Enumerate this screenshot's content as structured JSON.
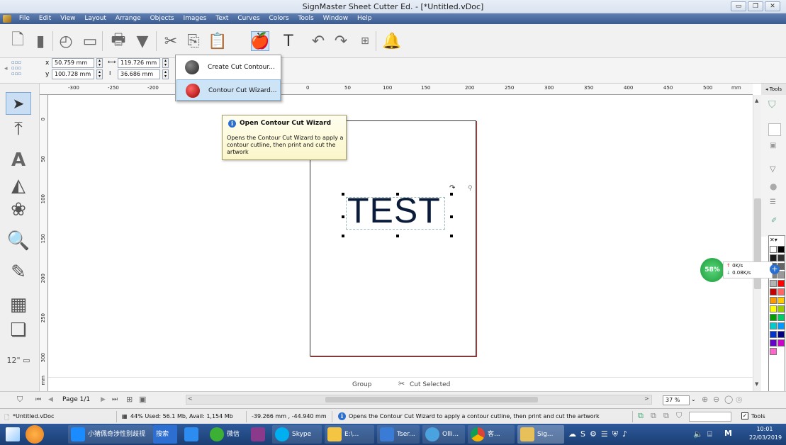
{
  "window": {
    "title": "SignMaster Sheet Cutter Ed. - [*Untitled.vDoc]",
    "controls": [
      "minimize",
      "maximize",
      "close"
    ]
  },
  "menu": [
    "File",
    "Edit",
    "View",
    "Layout",
    "Arrange",
    "Objects",
    "Images",
    "Text",
    "Curves",
    "Colors",
    "Tools",
    "Window",
    "Help"
  ],
  "toolbar": {
    "icons": [
      "new-document-icon",
      "open-icon",
      "recent-icon",
      "save-icon",
      "print-icon",
      "cut-plotter-icon",
      "scissors-icon",
      "copy-icon",
      "paste-icon",
      "contour-cut-icon",
      "text-icon",
      "undo-icon",
      "redo-icon",
      "align-icon",
      "bell-icon"
    ]
  },
  "properties": {
    "x": "50.759 mm",
    "y": "100.728 mm",
    "width": "119.726 mm",
    "height": "36.686 mm",
    "x_label": "x",
    "y_label": "y"
  },
  "dropdown": {
    "items": [
      {
        "label": "Create Cut Contour..."
      },
      {
        "label": "Contour Cut Wizard..."
      }
    ]
  },
  "tooltip": {
    "title": "Open Contour Cut Wizard",
    "body": "Opens the Contour Cut Wizard to apply a contour cutline, then print and cut the artwork"
  },
  "ruler": {
    "h_ticks": [
      "-300",
      "-250",
      "-200",
      "0",
      "50",
      "100",
      "150",
      "200",
      "250",
      "300",
      "350",
      "400",
      "450",
      "500",
      "mm"
    ],
    "v_ticks": [
      "0",
      "50",
      "100",
      "150",
      "200",
      "250",
      "300",
      "mm"
    ]
  },
  "docker": {
    "tab_label": "Tools"
  },
  "canvas": {
    "text": "TEST",
    "group_label": "Group",
    "cut_selected_label": "Cut Selected"
  },
  "netmon": {
    "percent": "58%",
    "up": "0K/s",
    "down": "0.08K/s"
  },
  "pagenav": {
    "page_label": "Page 1/1",
    "zoom": "37 %"
  },
  "status": {
    "filename": "*Untitled.vDoc",
    "memory": "44%  Used: 56.1 Mb, Avail: 1,154 Mb",
    "coords": "-39.266 mm , -44.940 mm",
    "message": "Opens the Contour Cut Wizard to apply a contour cutline, then print and cut the artwork",
    "tools_label": "Tools"
  },
  "taskbar": {
    "items": [
      {
        "label": "小猪佩奇涉性别歧视"
      },
      {
        "label": "搜索"
      },
      {
        "label": "微信"
      },
      {
        "label": "Skype"
      },
      {
        "label": "E:\\..."
      },
      {
        "label": "Tser..."
      },
      {
        "label": "Olli..."
      },
      {
        "label": "客..."
      },
      {
        "label": "Sig..."
      }
    ],
    "time": "10:01",
    "date": "22/03/2019",
    "ime": "M"
  },
  "colors": {
    "accent": "#2b6fd1",
    "menubar": "#3b5a8e",
    "palette": [
      "#ffffff",
      "#000000",
      "#1a1a1a",
      "#333333",
      "#4d4d4d",
      "#666666",
      "#808080",
      "#999999",
      "#b3b3b3",
      "#ff0000",
      "#c80000",
      "#ff6666",
      "#ff9900",
      "#ffcc00",
      "#ffff00",
      "#99cc00",
      "#00a000",
      "#00cc66",
      "#00cccc",
      "#0099ff",
      "#0033cc",
      "#000080",
      "#6600cc",
      "#cc00cc",
      "#ff66cc"
    ]
  }
}
